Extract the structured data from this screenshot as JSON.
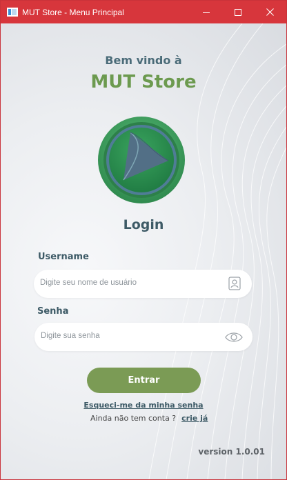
{
  "window": {
    "title": "MUT Store - Menu Principal",
    "titlebar_color": "#d7363c"
  },
  "header": {
    "welcome": "Bem vindo à",
    "brand": "MUT Store"
  },
  "login": {
    "title": "Login",
    "username_label": "Username",
    "username_placeholder": "Digite seu nome de usuário",
    "password_label": "Senha",
    "password_placeholder": "Digite sua senha",
    "submit_label": "Entrar",
    "forgot_link": "Esqueci-me da minha senha",
    "signup_prompt": "Ainda não tem conta  ?",
    "signup_link": "crie já"
  },
  "footer": {
    "version": "version 1.0.01"
  },
  "colors": {
    "accent_green": "#6c9a4f",
    "button_green": "#7b9b55",
    "text_teal": "#3d5a66"
  },
  "icons": [
    "app-icon",
    "minimize-icon",
    "maximize-icon",
    "close-icon",
    "user-card-icon",
    "eye-icon",
    "logo"
  ]
}
